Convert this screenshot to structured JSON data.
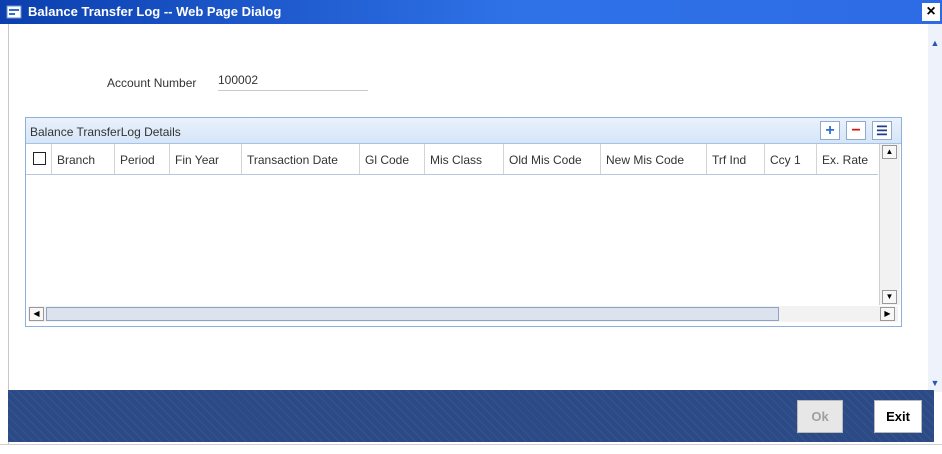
{
  "window": {
    "title": "Balance Transfer Log -- Web Page Dialog",
    "close_glyph": "×"
  },
  "account": {
    "label": "Account Number",
    "value": "100002"
  },
  "panel": {
    "title": "Balance TransferLog Details",
    "add_glyph": "+",
    "remove_glyph": "−",
    "list_glyph": "☰"
  },
  "columns": [
    "Branch",
    "Period",
    "Fin Year",
    "Transaction Date",
    "Gl Code",
    "Mis Class",
    "Old Mis Code",
    "New Mis Code",
    "Trf Ind",
    "Ccy 1",
    "Ex. Rate"
  ],
  "scroll": {
    "left": "◀",
    "right": "▶",
    "up": "▲",
    "down": "▼"
  },
  "buttons": {
    "ok": "Ok",
    "exit": "Exit"
  }
}
